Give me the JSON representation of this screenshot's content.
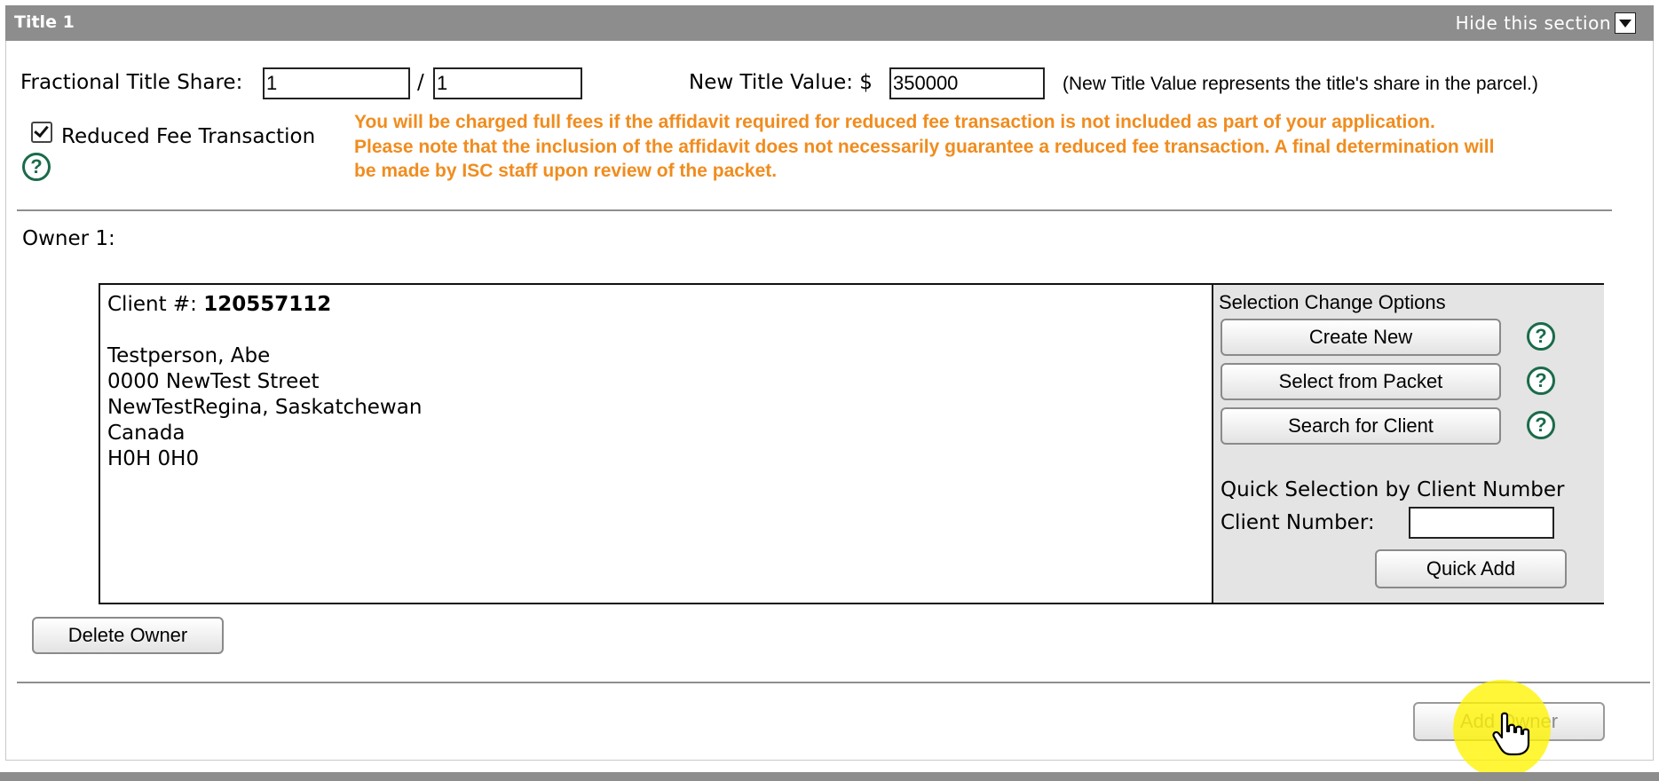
{
  "section": {
    "title": "Title 1",
    "hide_label": "Hide this section",
    "hide_icon": "dropdown-arrow-icon"
  },
  "title_share": {
    "label": "Fractional Title Share:",
    "numerator": "1",
    "separator": "/",
    "denominator": "1"
  },
  "title_value": {
    "label": "New Title Value: $",
    "value": "350000",
    "note": "(New Title Value represents the title's share in the parcel.)"
  },
  "reduced_fee": {
    "label": "Reduced Fee Transaction",
    "checked": true,
    "warning_line1": "You will be charged full fees if the affidavit required for reduced fee transaction is not included as part of your application.",
    "warning_line2": "Please note that the inclusion of the affidavit does not necessarily guarantee a reduced fee transaction. A final determination will",
    "warning_line3": "be made by ISC staff upon review of the packet."
  },
  "help_glyph": "?",
  "owner": {
    "heading": "Owner 1:",
    "client_label": "Client #:",
    "client_number": "120557112",
    "name": "Testperson, Abe",
    "street": "0000 NewTest Street",
    "city_province": "NewTestRegina, Saskatchewan",
    "country": "Canada",
    "postal_code": "H0H 0H0"
  },
  "selection_options": {
    "heading": "Selection Change Options",
    "create_new": "Create New",
    "select_from_packet": "Select from Packet",
    "search_for_client": "Search for Client",
    "quick_heading": "Quick Selection by Client Number",
    "client_number_label": "Client Number:",
    "client_number_value": "",
    "quick_add": "Quick Add"
  },
  "actions": {
    "delete_owner": "Delete Owner",
    "add_owner": "Add Owner"
  },
  "colors": {
    "header_bg": "#8d8d8d",
    "warning": "#f08c1e",
    "help_icon": "#1a6b4a",
    "panel_bg": "#e4e4e4",
    "cursor_highlight": "#fff400"
  }
}
